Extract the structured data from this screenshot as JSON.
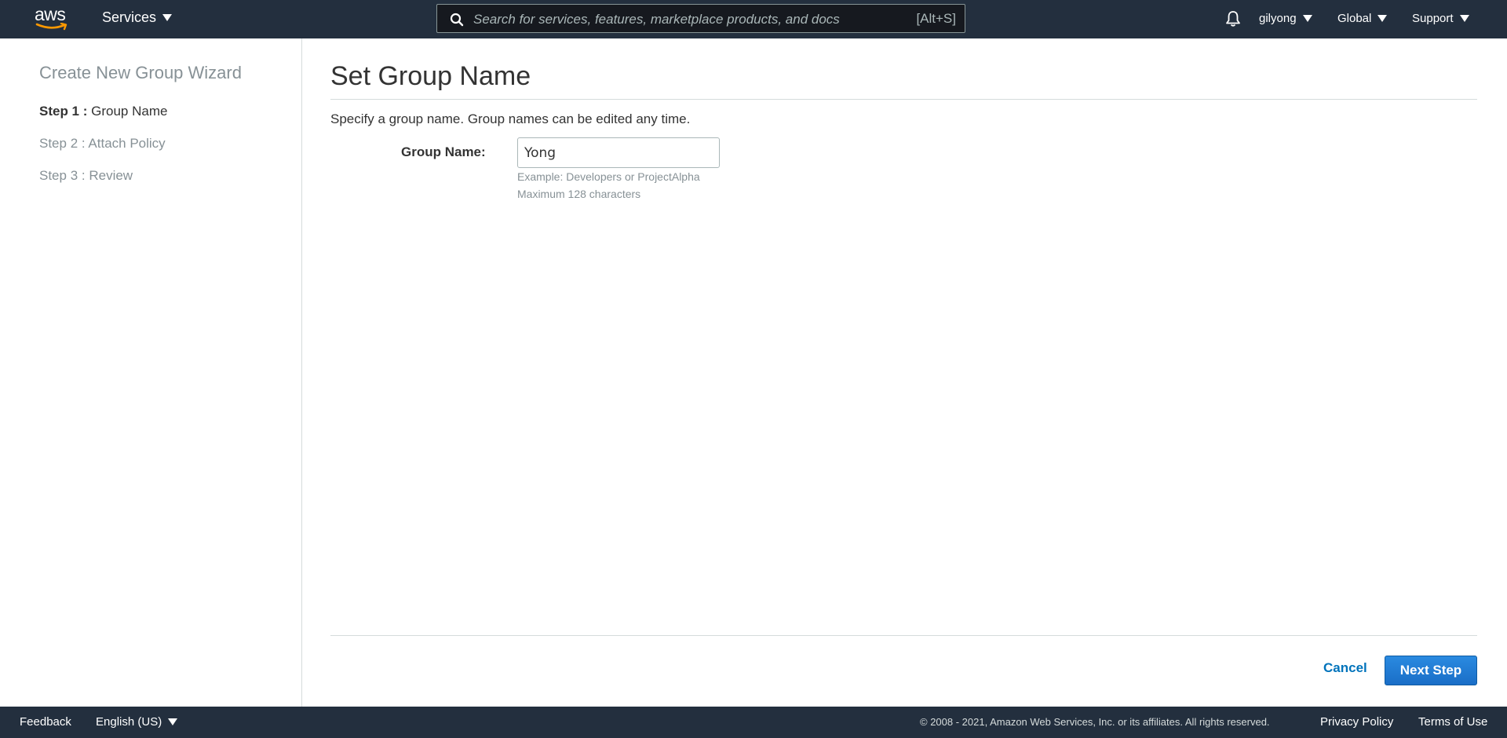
{
  "nav": {
    "logo_text": "aws",
    "services_label": "Services",
    "search_placeholder": "Search for services, features, marketplace products, and docs",
    "search_shortcut": "[Alt+S]",
    "account_label": "gilyong",
    "region_label": "Global",
    "support_label": "Support"
  },
  "sidebar": {
    "title": "Create New Group Wizard",
    "steps": [
      {
        "label": "Step 1 :",
        "name": "Group Name",
        "active": true
      },
      {
        "label": "Step 2 :",
        "name": "Attach Policy",
        "active": false
      },
      {
        "label": "Step 3 :",
        "name": "Review",
        "active": false
      }
    ]
  },
  "main": {
    "title": "Set Group Name",
    "description": "Specify a group name. Group names can be edited any time.",
    "field_label": "Group Name:",
    "field_value": "Yong",
    "hint_example": "Example: Developers or ProjectAlpha",
    "hint_max": "Maximum 128 characters",
    "cancel_label": "Cancel",
    "next_label": "Next Step"
  },
  "footer": {
    "feedback_label": "Feedback",
    "language_label": "English (US)",
    "copyright": "© 2008 - 2021, Amazon Web Services, Inc. or its affiliates. All rights reserved.",
    "privacy_label": "Privacy Policy",
    "terms_label": "Terms of Use"
  },
  "colors": {
    "nav_bg": "#232f3e",
    "link_blue": "#0073bb",
    "primary_button": "#1a6ec7",
    "aws_orange": "#ff9900"
  },
  "icons": [
    "aws-logo",
    "search-icon",
    "bell-icon",
    "caret-down-icon"
  ]
}
